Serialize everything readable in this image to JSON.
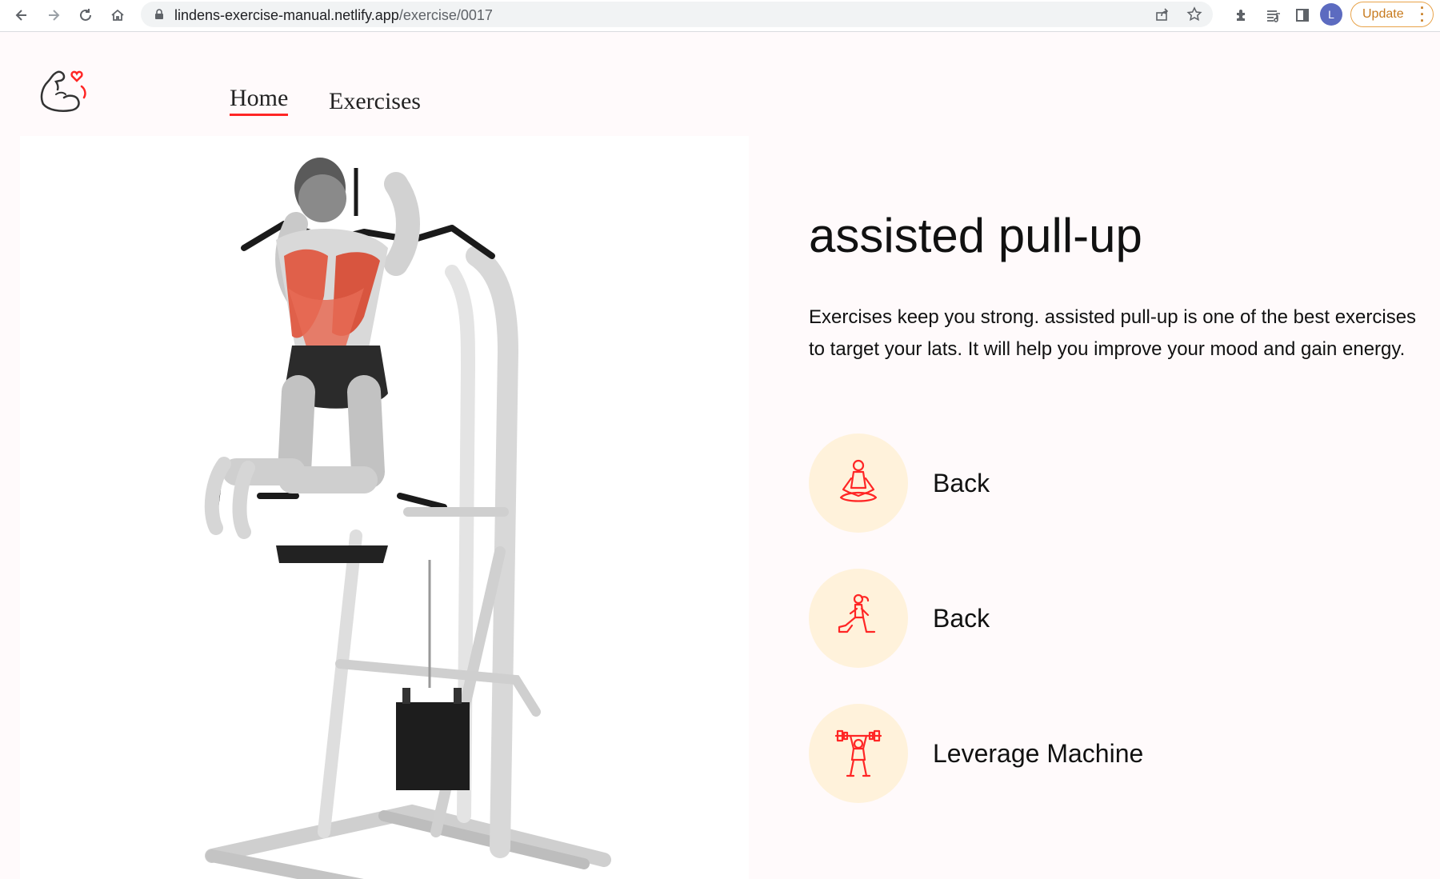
{
  "browser": {
    "url_host": "lindens-exercise-manual.netlify.app",
    "url_path": "/exercise/0017",
    "profile_initial": "L",
    "update_label": "Update",
    "icons": [
      "back-icon",
      "forward-icon",
      "reload-icon",
      "home-icon",
      "lock-icon",
      "share-icon",
      "bookmark-star-icon",
      "extensions-icon",
      "reading-list-icon",
      "side-panel-icon",
      "menu-dots-icon"
    ]
  },
  "nav": {
    "home_label": "Home",
    "exercises_label": "Exercises"
  },
  "exercise": {
    "name": "assisted pull-up",
    "description": "Exercises keep you strong. assisted pull-up is one of the best exercises to target your lats. It will help you improve your mood and gain energy.",
    "details": [
      {
        "label": "Back",
        "icon": "yoga-body-part-icon"
      },
      {
        "label": "Back",
        "icon": "lunge-target-icon"
      },
      {
        "label": "Leverage Machine",
        "icon": "dumbbell-equipment-icon"
      }
    ]
  },
  "colors": {
    "accent_red": "#ff2625",
    "icon_bg": "#fff2db",
    "page_bg": "#fffafb",
    "highlight_muscle": "#e0604a"
  }
}
